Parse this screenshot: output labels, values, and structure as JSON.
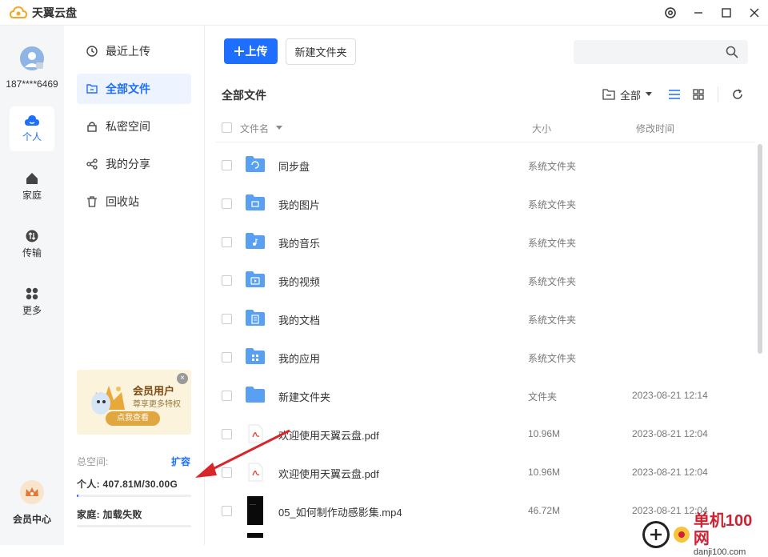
{
  "app": {
    "title": "天翼云盘"
  },
  "user": {
    "phone": "187****6469"
  },
  "leftnav": [
    {
      "id": "personal",
      "label": "个人",
      "icon": "cloud-icon",
      "active": true
    },
    {
      "id": "family",
      "label": "家庭",
      "icon": "home-icon"
    },
    {
      "id": "transfer",
      "label": "传输",
      "icon": "transfer-icon"
    },
    {
      "id": "more",
      "label": "更多",
      "icon": "grid-icon"
    }
  ],
  "vip_center": {
    "label": "会员中心"
  },
  "sidebar": {
    "items": [
      {
        "label": "最近上传",
        "icon": "clock-icon"
      },
      {
        "label": "全部文件",
        "icon": "folder-icon",
        "active": true
      },
      {
        "label": "私密空间",
        "icon": "lock-icon"
      },
      {
        "label": "我的分享",
        "icon": "share-icon"
      },
      {
        "label": "回收站",
        "icon": "trash-icon"
      }
    ],
    "banner": {
      "title": "会员用户",
      "subtitle": "尊享更多特权",
      "button": "点我查看",
      "close": "×"
    },
    "storage": {
      "label": "总空间:",
      "expand": "扩容",
      "personal": "个人: 407.81M/30.00G",
      "personal_fraction": 0.013,
      "family": "家庭: 加载失败"
    }
  },
  "toolbar": {
    "upload_label": "上传",
    "new_folder_label": "新建文件夹",
    "search_placeholder": ""
  },
  "heading": "全部文件",
  "filter_label": "全部",
  "table": {
    "columns": {
      "name": "文件名",
      "size": "大小",
      "time": "修改时间"
    },
    "rows": [
      {
        "name": "同步盘",
        "size": "系统文件夹",
        "time": "",
        "icon": "sync-folder-icon"
      },
      {
        "name": "我的图片",
        "size": "系统文件夹",
        "time": "",
        "icon": "image-folder-icon"
      },
      {
        "name": "我的音乐",
        "size": "系统文件夹",
        "time": "",
        "icon": "music-folder-icon"
      },
      {
        "name": "我的视频",
        "size": "系统文件夹",
        "time": "",
        "icon": "video-folder-icon"
      },
      {
        "name": "我的文档",
        "size": "系统文件夹",
        "time": "",
        "icon": "doc-folder-icon"
      },
      {
        "name": "我的应用",
        "size": "系统文件夹",
        "time": "",
        "icon": "app-folder-icon"
      },
      {
        "name": "新建文件夹",
        "size": "文件夹",
        "time": "2023-08-21 12:14",
        "icon": "folder-icon"
      },
      {
        "name": "欢迎使用天翼云盘.pdf",
        "size": "10.96M",
        "time": "2023-08-21 12:04",
        "icon": "pdf-icon"
      },
      {
        "name": "欢迎使用天翼云盘.pdf",
        "size": "10.96M",
        "time": "2023-08-21 12:04",
        "icon": "pdf-icon"
      },
      {
        "name": "05_如何制作动感影集.mp4",
        "size": "46.72M",
        "time": "2023-08-21 12:04",
        "icon": "video-thumbnail-icon"
      }
    ]
  },
  "watermark": {
    "brand": "单机100网",
    "url": "danji100.com"
  },
  "colors": {
    "accent": "#1e6fff",
    "annotation_arrow": "#d9262b"
  }
}
